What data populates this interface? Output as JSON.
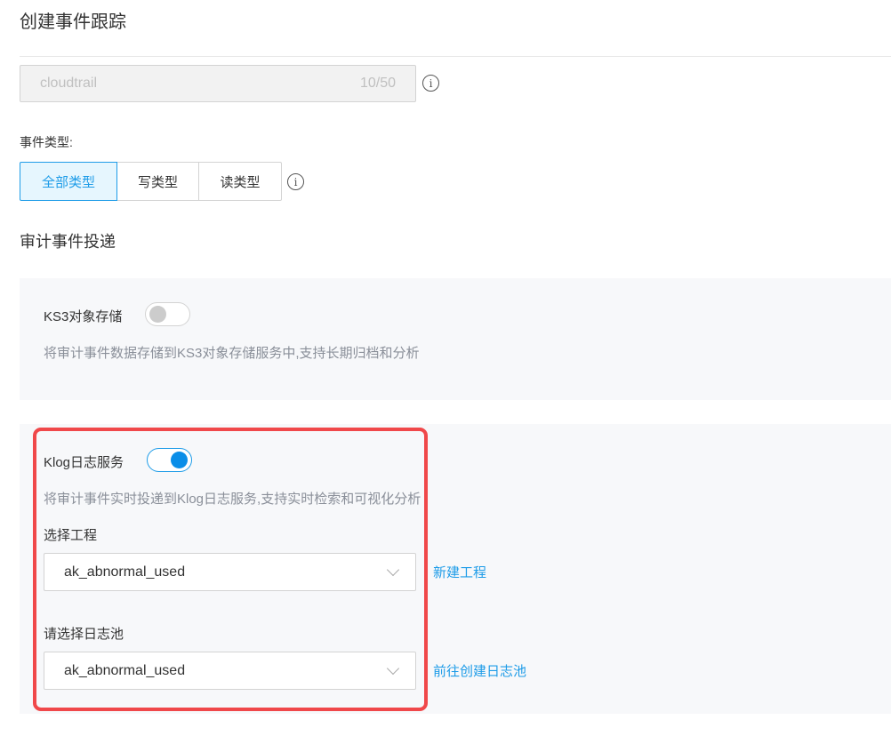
{
  "page": {
    "title": "创建事件跟踪"
  },
  "name_input": {
    "value": "cloudtrail",
    "counter": "10/50"
  },
  "event_type": {
    "label": "事件类型:",
    "options": [
      {
        "label": "全部类型",
        "selected": true
      },
      {
        "label": "写类型",
        "selected": false
      },
      {
        "label": "读类型",
        "selected": false
      }
    ]
  },
  "icons": {
    "info": "i"
  },
  "delivery": {
    "title": "审计事件投递",
    "ks3": {
      "label": "KS3对象存储",
      "enabled": false,
      "description": "将审计事件数据存储到KS3对象存储服务中,支持长期归档和分析"
    },
    "klog": {
      "label": "Klog日志服务",
      "enabled": true,
      "description": "将审计事件实时投递到Klog日志服务,支持实时检索和可视化分析",
      "project_label": "选择工程",
      "project_value": "ak_abnormal_used",
      "project_link": "新建工程",
      "pool_label": "请选择日志池",
      "pool_value": "ak_abnormal_used",
      "pool_link": "前往创建日志池"
    }
  },
  "colors": {
    "accent": "#1e9ce8",
    "highlight": "#f0484a"
  }
}
